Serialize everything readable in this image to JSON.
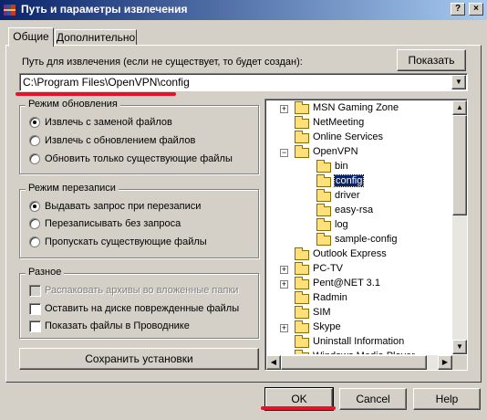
{
  "window": {
    "title": "Путь и параметры извлечения",
    "help_btn": "?",
    "close_btn": "×"
  },
  "tabs": [
    {
      "label": "Общие"
    },
    {
      "label": "Дополнительно"
    }
  ],
  "path": {
    "label": "Путь для извлечения (если не существует, то будет создан):",
    "value": "C:\\Program Files\\OpenVPN\\config",
    "show_button": "Показать"
  },
  "update_mode": {
    "label": "Режим обновления",
    "options": [
      {
        "label": "Извлечь с заменой файлов",
        "selected": true
      },
      {
        "label": "Извлечь с обновлением файлов",
        "selected": false
      },
      {
        "label": "Обновить только существующие файлы",
        "selected": false
      }
    ]
  },
  "overwrite_mode": {
    "label": "Режим перезаписи",
    "options": [
      {
        "label": "Выдавать запрос при перезаписи",
        "selected": true
      },
      {
        "label": "Перезаписывать без запроса",
        "selected": false
      },
      {
        "label": "Пропускать существующие файлы",
        "selected": false
      }
    ]
  },
  "misc": {
    "label": "Разное",
    "options": [
      {
        "label": "Распаковать архивы во вложенные папки",
        "checked": false,
        "disabled": true
      },
      {
        "label": "Оставить на диске поврежденные файлы",
        "checked": false,
        "disabled": false
      },
      {
        "label": "Показать файлы в Проводнике",
        "checked": false,
        "disabled": false
      }
    ]
  },
  "save_button": "Сохранить установки",
  "tree": [
    {
      "label": "MSN Gaming Zone",
      "expander": "+"
    },
    {
      "label": "NetMeeting"
    },
    {
      "label": "Online Services"
    },
    {
      "label": "OpenVPN",
      "expander": "−"
    },
    {
      "label": "bin",
      "indent": 1
    },
    {
      "label": "config",
      "indent": 1,
      "selected": true
    },
    {
      "label": "driver",
      "indent": 1
    },
    {
      "label": "easy-rsa",
      "indent": 1
    },
    {
      "label": "log",
      "indent": 1
    },
    {
      "label": "sample-config",
      "indent": 1
    },
    {
      "label": "Outlook Express"
    },
    {
      "label": "PC-TV",
      "expander": "+"
    },
    {
      "label": "Pent@NET 3.1",
      "expander": "+"
    },
    {
      "label": "Radmin"
    },
    {
      "label": "SIM"
    },
    {
      "label": "Skype",
      "expander": "+"
    },
    {
      "label": "Uninstall Information"
    },
    {
      "label": "Windows Media Player"
    }
  ],
  "footer": {
    "ok": "OK",
    "cancel": "Cancel",
    "help": "Help"
  },
  "colors": {
    "title_start": "#0a246a",
    "title_end": "#a6caf0",
    "selection": "#0a246a",
    "annotation_red": "#e8102a"
  },
  "icons": {
    "app": "winrar-books-icon",
    "folder": "folder-icon"
  }
}
